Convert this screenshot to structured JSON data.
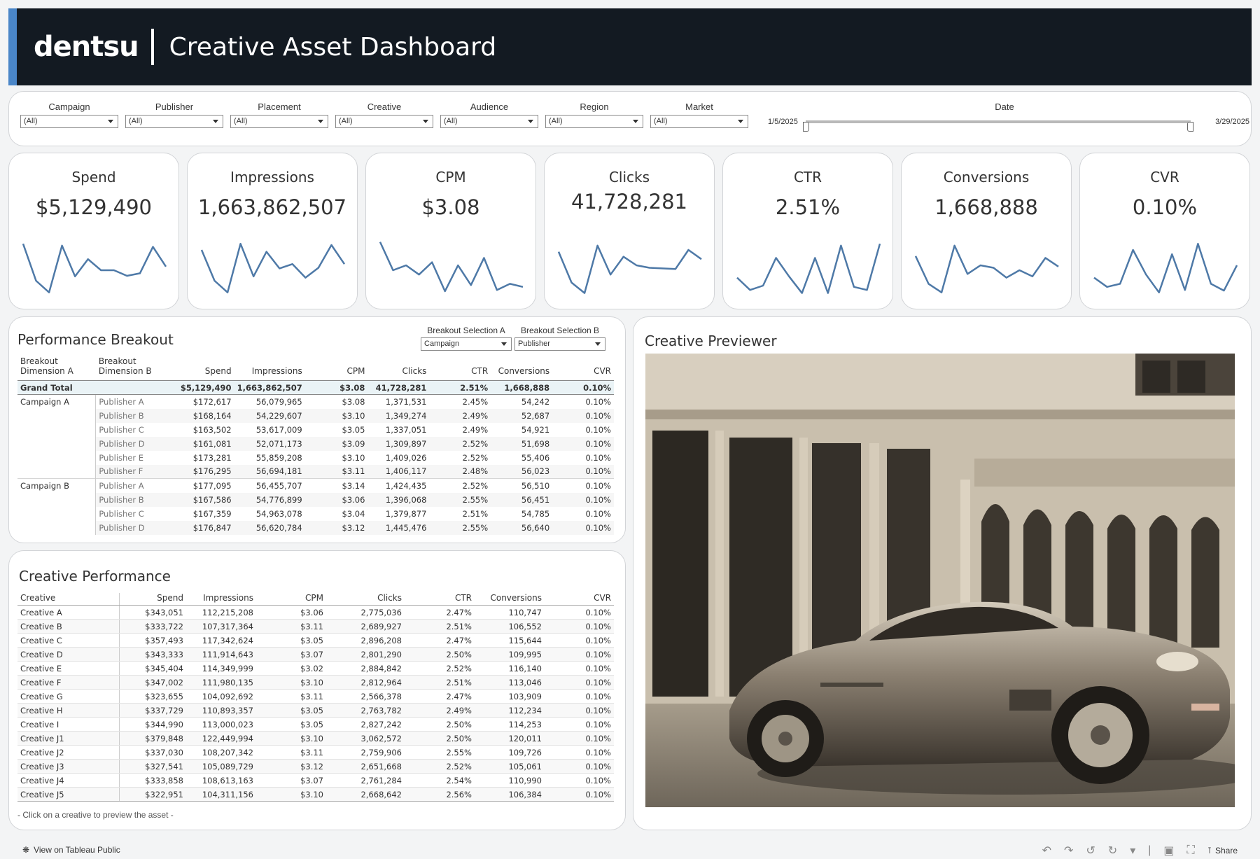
{
  "header": {
    "logo": "dentsu",
    "title": "Creative Asset Dashboard",
    "accent": "#4a86c8",
    "bg": "#131a22"
  },
  "filters": [
    {
      "label": "Campaign",
      "value": "(All)"
    },
    {
      "label": "Publisher",
      "value": "(All)"
    },
    {
      "label": "Placement",
      "value": "(All)"
    },
    {
      "label": "Creative",
      "value": "(All)"
    },
    {
      "label": "Audience",
      "value": "(All)"
    },
    {
      "label": "Region",
      "value": "(All)"
    },
    {
      "label": "Market",
      "value": "(All)"
    }
  ],
  "date": {
    "label": "Date",
    "start": "1/5/2025",
    "end": "3/29/2025"
  },
  "kpis": [
    {
      "label": "Spend",
      "value": "$5,129,490",
      "trend": [
        0.85,
        0.25,
        0.06,
        0.82,
        0.32,
        0.6,
        0.42,
        0.42,
        0.33,
        0.37,
        0.8,
        0.48
      ]
    },
    {
      "label": "Impressions",
      "value": "1,663,862,507",
      "trend": [
        0.75,
        0.25,
        0.06,
        0.85,
        0.32,
        0.72,
        0.45,
        0.52,
        0.3,
        0.46,
        0.83,
        0.52
      ]
    },
    {
      "label": "CPM",
      "value": "$3.08",
      "trend": [
        0.88,
        0.42,
        0.5,
        0.35,
        0.55,
        0.08,
        0.5,
        0.18,
        0.62,
        0.1,
        0.2,
        0.15
      ]
    },
    {
      "label": "Clicks",
      "value": "41,728,281",
      "trend": [
        0.72,
        0.22,
        0.05,
        0.82,
        0.35,
        0.64,
        0.5,
        0.46,
        0.45,
        0.44,
        0.75,
        0.6
      ]
    },
    {
      "label": "CTR",
      "value": "2.51%",
      "trend": [
        0.3,
        0.1,
        0.17,
        0.62,
        0.32,
        0.05,
        0.62,
        0.05,
        0.82,
        0.15,
        0.1,
        0.85
      ]
    },
    {
      "label": "Conversions",
      "value": "1,668,888",
      "trend": [
        0.65,
        0.2,
        0.06,
        0.82,
        0.36,
        0.5,
        0.46,
        0.3,
        0.42,
        0.32,
        0.62,
        0.48
      ]
    },
    {
      "label": "CVR",
      "value": "0.10%",
      "trend": [
        0.3,
        0.15,
        0.2,
        0.75,
        0.35,
        0.06,
        0.68,
        0.1,
        0.85,
        0.2,
        0.09,
        0.5
      ]
    }
  ],
  "breakout": {
    "title": "Performance Breakout",
    "selA": {
      "label": "Breakout Selection A",
      "value": "Campaign"
    },
    "selB": {
      "label": "Breakout Selection B",
      "value": "Publisher"
    },
    "headers": {
      "dimA": "Breakout Dimension A",
      "dimB": "Breakout Dimension B",
      "spend": "Spend",
      "impressions": "Impressions",
      "cpm": "CPM",
      "clicks": "Clicks",
      "ctr": "CTR",
      "conversions": "Conversions",
      "cvr": "CVR"
    },
    "grand_total": {
      "label": "Grand Total",
      "spend": "$5,129,490",
      "impressions": "1,663,862,507",
      "cpm": "$3.08",
      "clicks": "41,728,281",
      "ctr": "2.51%",
      "conversions": "1,668,888",
      "cvr": "0.10%"
    },
    "rows": [
      [
        "Campaign A",
        "Publisher A",
        "$172,617",
        "56,079,965",
        "$3.08",
        "1,371,531",
        "2.45%",
        "54,242",
        "0.10%"
      ],
      [
        "",
        "Publisher B",
        "$168,164",
        "54,229,607",
        "$3.10",
        "1,349,274",
        "2.49%",
        "52,687",
        "0.10%"
      ],
      [
        "",
        "Publisher C",
        "$163,502",
        "53,617,009",
        "$3.05",
        "1,337,051",
        "2.49%",
        "54,921",
        "0.10%"
      ],
      [
        "",
        "Publisher D",
        "$161,081",
        "52,071,173",
        "$3.09",
        "1,309,897",
        "2.52%",
        "51,698",
        "0.10%"
      ],
      [
        "",
        "Publisher E",
        "$173,281",
        "55,859,208",
        "$3.10",
        "1,409,026",
        "2.52%",
        "55,406",
        "0.10%"
      ],
      [
        "",
        "Publisher F",
        "$176,295",
        "56,694,181",
        "$3.11",
        "1,406,117",
        "2.48%",
        "56,023",
        "0.10%"
      ],
      [
        "Campaign B",
        "Publisher A",
        "$177,095",
        "56,455,707",
        "$3.14",
        "1,424,435",
        "2.52%",
        "56,510",
        "0.10%"
      ],
      [
        "",
        "Publisher B",
        "$167,586",
        "54,776,899",
        "$3.06",
        "1,396,068",
        "2.55%",
        "56,451",
        "0.10%"
      ],
      [
        "",
        "Publisher C",
        "$167,359",
        "54,963,078",
        "$3.04",
        "1,379,877",
        "2.51%",
        "54,785",
        "0.10%"
      ],
      [
        "",
        "Publisher D",
        "$176,847",
        "56,620,784",
        "$3.12",
        "1,445,476",
        "2.55%",
        "56,640",
        "0.10%"
      ]
    ]
  },
  "creative": {
    "title": "Creative Performance",
    "headers": {
      "creative": "Creative",
      "spend": "Spend",
      "impressions": "Impressions",
      "cpm": "CPM",
      "clicks": "Clicks",
      "ctr": "CTR",
      "conversions": "Conversions",
      "cvr": "CVR"
    },
    "rows": [
      [
        "Creative A",
        "$343,051",
        "112,215,208",
        "$3.06",
        "2,775,036",
        "2.47%",
        "110,747",
        "0.10%"
      ],
      [
        "Creative B",
        "$333,722",
        "107,317,364",
        "$3.11",
        "2,689,927",
        "2.51%",
        "106,552",
        "0.10%"
      ],
      [
        "Creative C",
        "$357,493",
        "117,342,624",
        "$3.05",
        "2,896,208",
        "2.47%",
        "115,644",
        "0.10%"
      ],
      [
        "Creative D",
        "$343,333",
        "111,914,643",
        "$3.07",
        "2,801,290",
        "2.50%",
        "109,995",
        "0.10%"
      ],
      [
        "Creative E",
        "$345,404",
        "114,349,999",
        "$3.02",
        "2,884,842",
        "2.52%",
        "116,140",
        "0.10%"
      ],
      [
        "Creative F",
        "$347,002",
        "111,980,135",
        "$3.10",
        "2,812,964",
        "2.51%",
        "113,046",
        "0.10%"
      ],
      [
        "Creative G",
        "$323,655",
        "104,092,692",
        "$3.11",
        "2,566,378",
        "2.47%",
        "103,909",
        "0.10%"
      ],
      [
        "Creative H",
        "$337,729",
        "110,893,357",
        "$3.05",
        "2,763,782",
        "2.49%",
        "112,234",
        "0.10%"
      ],
      [
        "Creative I",
        "$344,990",
        "113,000,023",
        "$3.05",
        "2,827,242",
        "2.50%",
        "114,253",
        "0.10%"
      ],
      [
        "Creative J1",
        "$379,848",
        "122,449,994",
        "$3.10",
        "3,062,572",
        "2.50%",
        "120,011",
        "0.10%"
      ],
      [
        "Creative J2",
        "$337,030",
        "108,207,342",
        "$3.11",
        "2,759,906",
        "2.55%",
        "109,726",
        "0.10%"
      ],
      [
        "Creative J3",
        "$327,541",
        "105,089,729",
        "$3.12",
        "2,651,668",
        "2.52%",
        "105,061",
        "0.10%"
      ],
      [
        "Creative J4",
        "$333,858",
        "108,613,163",
        "$3.07",
        "2,761,284",
        "2.54%",
        "110,990",
        "0.10%"
      ],
      [
        "Creative J5",
        "$322,951",
        "104,311,156",
        "$3.10",
        "2,668,642",
        "2.56%",
        "106,384",
        "0.10%"
      ]
    ],
    "hint": "- Click on a creative to preview the asset -"
  },
  "previewer": {
    "title": "Creative Previewer"
  },
  "footer": {
    "view_label": "View on Tableau Public",
    "share_label": "Share"
  },
  "colors": {
    "spark": "#4e79a7"
  }
}
